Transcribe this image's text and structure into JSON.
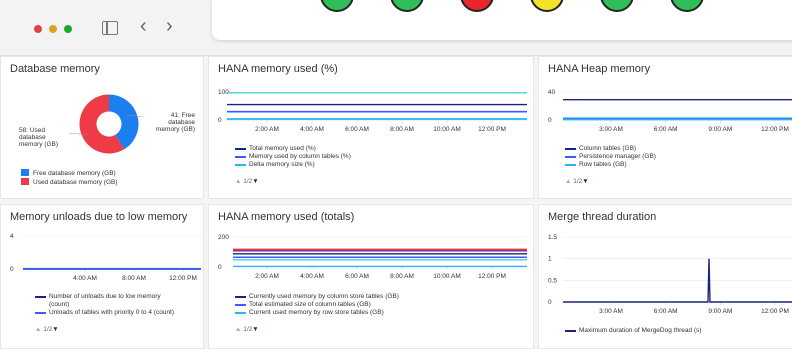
{
  "window": {
    "controls": {
      "close": "close",
      "minimize": "minimize",
      "maximize": "maximize"
    }
  },
  "toolbar": {
    "back_glyph": "‹",
    "forward_glyph": "›"
  },
  "status_circle_colors": [
    "#2fbf5a",
    "#2fbf5a",
    "#e8262c",
    "#f4e12a",
    "#2fbf5a",
    "#2fbf5a"
  ],
  "tiles": [
    {
      "title": "Database memory",
      "chart_data": {
        "type": "pie",
        "categories": [
          "Free database memory (GB)",
          "Used database memory (GB)"
        ],
        "values": [
          41,
          58
        ],
        "colors": [
          "#1b7ff0",
          "#ef3b45"
        ],
        "labels": [
          "41: Free database memory (GB)",
          "58: Used database memory (GB)"
        ]
      },
      "label_free": [
        "41: Free",
        "database",
        "memory (GB)"
      ],
      "label_used": [
        "58: Used",
        "database",
        "memory (GB)"
      ],
      "legend": [
        "Free database memory (GB)",
        "Used database memory (GB)"
      ]
    },
    {
      "title": "HANA memory used (%)",
      "chart_data": {
        "type": "line",
        "y_ticks": [
          "100",
          "0"
        ],
        "ylim": [
          0,
          100
        ],
        "x_ticks": [
          "2:00 AM",
          "4:00 AM",
          "6:00 AM",
          "8:00 AM",
          "10:00 AM",
          "12:00 PM"
        ],
        "series": [
          {
            "name": "Total memory used (%)",
            "value": 55,
            "color": "#1a237e"
          },
          {
            "name": "Memory used by column tables (%)",
            "value": 30,
            "color": "#3d5afe"
          },
          {
            "name": "Delta memory size (%)",
            "value": 4,
            "color": "#29b6f6"
          }
        ],
        "extra_lines": [
          {
            "value": 97,
            "color": "#4dd0e1"
          },
          {
            "value": 28,
            "color": "#80d8ff"
          },
          {
            "value": 2,
            "color": "#4dd0e1"
          }
        ]
      },
      "pager": "1/2"
    },
    {
      "title": "HANA Heap memory",
      "chart_data": {
        "type": "line",
        "y_ticks": [
          "40",
          "0"
        ],
        "ylim": [
          0,
          40
        ],
        "x_ticks": [
          "3:00 AM",
          "6:00 AM",
          "9:00 AM",
          "12:00 PM"
        ],
        "series": [
          {
            "name": "Column tables (GB)",
            "value": 29,
            "color": "#1a237e"
          },
          {
            "name": "Persistence manager (GB)",
            "value": 1.5,
            "color": "#3d5afe"
          },
          {
            "name": "Row tables (GB)",
            "value": 0.5,
            "color": "#29b6f6"
          }
        ],
        "extra_lines": [
          {
            "value": 3,
            "color": "#4dd0e1"
          }
        ]
      },
      "pager": "1/2"
    },
    {
      "title": "Memory unloads due to low memory",
      "chart_data": {
        "type": "line",
        "y_ticks": [
          "4",
          "0"
        ],
        "ylim": [
          0,
          4
        ],
        "x_ticks": [
          "4:00 AM",
          "8:00 AM",
          "12:00 PM"
        ],
        "series": [
          {
            "name": "Number of unloads due to low memory (count)",
            "value": 0,
            "color": "#1a237e"
          },
          {
            "name": "Unloads of tables with priority 0 to 4 (count)",
            "value": 0,
            "color": "#3d5afe"
          }
        ],
        "extra_lines": [
          {
            "value": 0.05,
            "color": "#29b6f6"
          }
        ]
      },
      "legend_lines": [
        [
          "Number of unloads due to low memory",
          "(count)"
        ],
        [
          "Unloads of tables with priority 0 to 4 (count)"
        ]
      ],
      "pager": "1/2"
    },
    {
      "title": "HANA memory used (totals)",
      "chart_data": {
        "type": "line",
        "y_ticks": [
          "200",
          "0"
        ],
        "ylim": [
          0,
          200
        ],
        "x_ticks": [
          "2:00 AM",
          "4:00 AM",
          "6:00 AM",
          "8:00 AM",
          "10:00 AM",
          "12:00 PM"
        ],
        "series": [
          {
            "name": "Currently used memory by column store tables (GB)",
            "value": 88,
            "color": "#1a237e"
          },
          {
            "name": "Total estimated size of column tables (GB)",
            "value": 65,
            "color": "#3d5afe"
          },
          {
            "name": "Current used memory by row store tables (GB)",
            "value": 4,
            "color": "#29b6f6"
          }
        ],
        "extra_lines": [
          {
            "value": 118,
            "color": "#e53935"
          },
          {
            "value": 108,
            "color": "#6a1b9a"
          },
          {
            "value": 48,
            "color": "#4dd0e1"
          }
        ]
      },
      "pager": "1/2"
    },
    {
      "title": "Merge thread duration",
      "chart_data": {
        "type": "line",
        "y_ticks": [
          "1.5",
          "1",
          "0.5",
          "0"
        ],
        "ylim": [
          0,
          1.5
        ],
        "x_ticks": [
          "3:00 AM",
          "6:00 AM",
          "9:00 AM",
          "12:00 PM"
        ],
        "series": [
          {
            "name": "Maximum duration of MergeDog thread (s)",
            "baseline": 0,
            "spike_x": "8:20 AM",
            "spike_value": 1,
            "color": "#1a237e"
          }
        ]
      }
    }
  ]
}
